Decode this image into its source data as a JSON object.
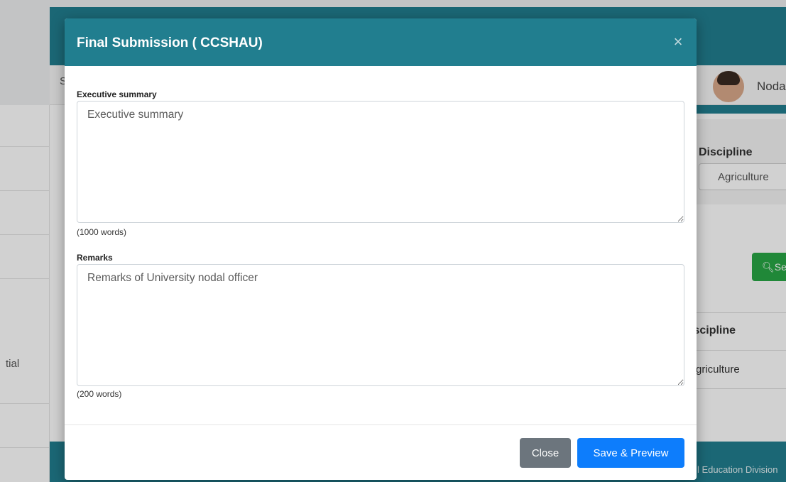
{
  "modal": {
    "title": "Final Submission ( CCSHAU)",
    "close_icon": "×",
    "executive_summary": {
      "label": "Executive summary",
      "placeholder": "Executive summary",
      "value": "",
      "hint": "(1000 words)"
    },
    "remarks": {
      "label": "Remarks",
      "placeholder": "Remarks of University nodal officer",
      "value": "",
      "hint": "(200 words)"
    },
    "buttons": {
      "close": "Close",
      "save": "Save & Preview"
    }
  },
  "background": {
    "subbar_letter": "S",
    "user_name": "Noda",
    "sidebar_partial_text": "tial",
    "discipline_label": "Discipline",
    "discipline_value": "Agriculture",
    "search_button": "Se",
    "table_header": "iscipline",
    "table_cell": "griculture",
    "footer_text": "l Education Division"
  },
  "colors": {
    "header_teal": "#217e8f",
    "close_gray": "#6c757d",
    "save_blue": "#0d7dfc",
    "search_green": "#28a745"
  }
}
